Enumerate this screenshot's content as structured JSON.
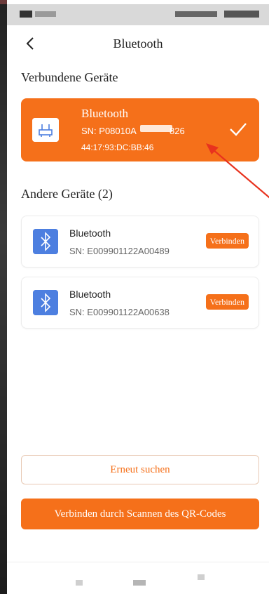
{
  "nav": {
    "title": "Bluetooth"
  },
  "connected_section": {
    "title": "Verbundene Geräte",
    "device": {
      "name": "Bluetooth",
      "sn_start": "SN: P08010A",
      "sn_end": "826",
      "mac": "44:17:93:DC:BB:46"
    }
  },
  "other_section": {
    "title": "Andere Geräte (2)",
    "devices": [
      {
        "name": "Bluetooth",
        "sn": "SN: E009901122A00489",
        "button": "Verbinden"
      },
      {
        "name": "Bluetooth",
        "sn": "SN: E009901122A00638",
        "button": "Verbinden"
      }
    ]
  },
  "actions": {
    "rescan": "Erneut suchen",
    "scan_qr": "Verbinden durch Scannen des QR-Codes"
  },
  "colors": {
    "accent": "#f5701a",
    "bluetooth_icon_bg": "#4d7fe0"
  }
}
